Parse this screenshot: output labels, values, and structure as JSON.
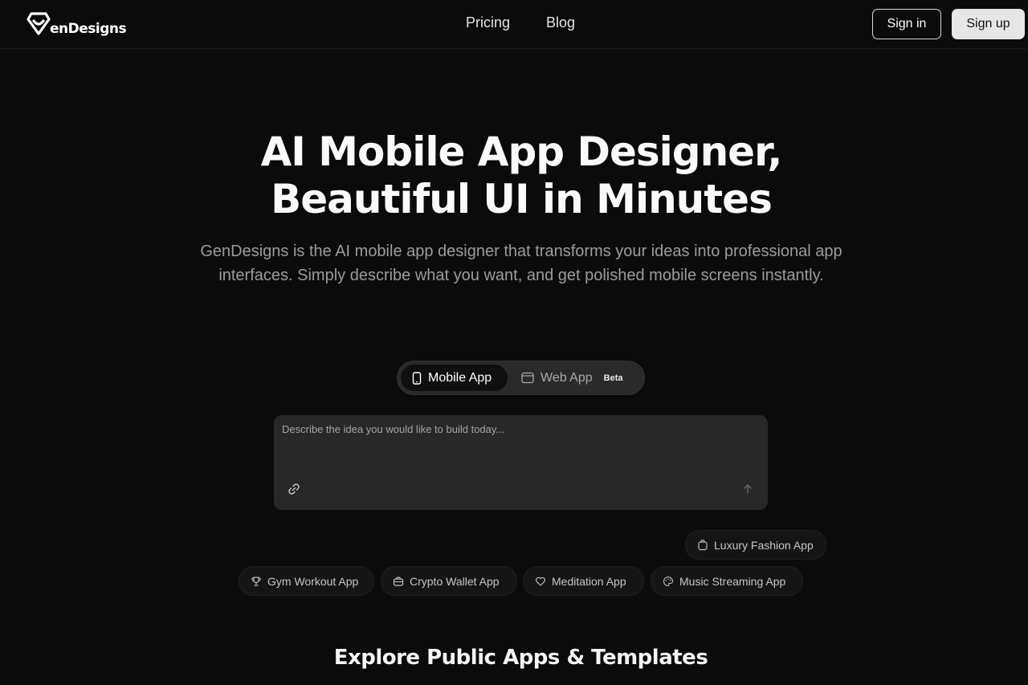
{
  "brand": {
    "name": "enDesigns",
    "accent": "#ffffff"
  },
  "nav": {
    "items": [
      "Pricing",
      "Blog"
    ]
  },
  "auth": {
    "signin": "Sign in",
    "signup": "Sign up"
  },
  "hero": {
    "title_line1": "AI Mobile App Designer,",
    "title_line2": "Beautiful UI in Minutes",
    "subtitle": "GenDesigns is the AI mobile app designer that transforms your ideas into professional app interfaces. Simply describe what you want, and get polished mobile screens instantly."
  },
  "toggle": {
    "mobile": "Mobile App",
    "web": "Web App",
    "beta": "Beta",
    "selected": "Mobile App"
  },
  "prompt": {
    "placeholder": "Describe the idea you would like to build today...",
    "value": ""
  },
  "suggestions": [
    {
      "label": "Luxury Fashion App",
      "icon": "shopping-bag-icon"
    },
    {
      "label": "Gym Workout App",
      "icon": "trophy-icon"
    },
    {
      "label": "Crypto Wallet App",
      "icon": "briefcase-icon"
    },
    {
      "label": "Meditation App",
      "icon": "heart-icon"
    },
    {
      "label": "Music Streaming App",
      "icon": "palette-icon"
    }
  ],
  "explore": {
    "title": "Explore Public Apps & Templates"
  },
  "colors": {
    "background": "#0b0b0b",
    "panel": "#282828",
    "muted_text": "#9c9c9c"
  }
}
